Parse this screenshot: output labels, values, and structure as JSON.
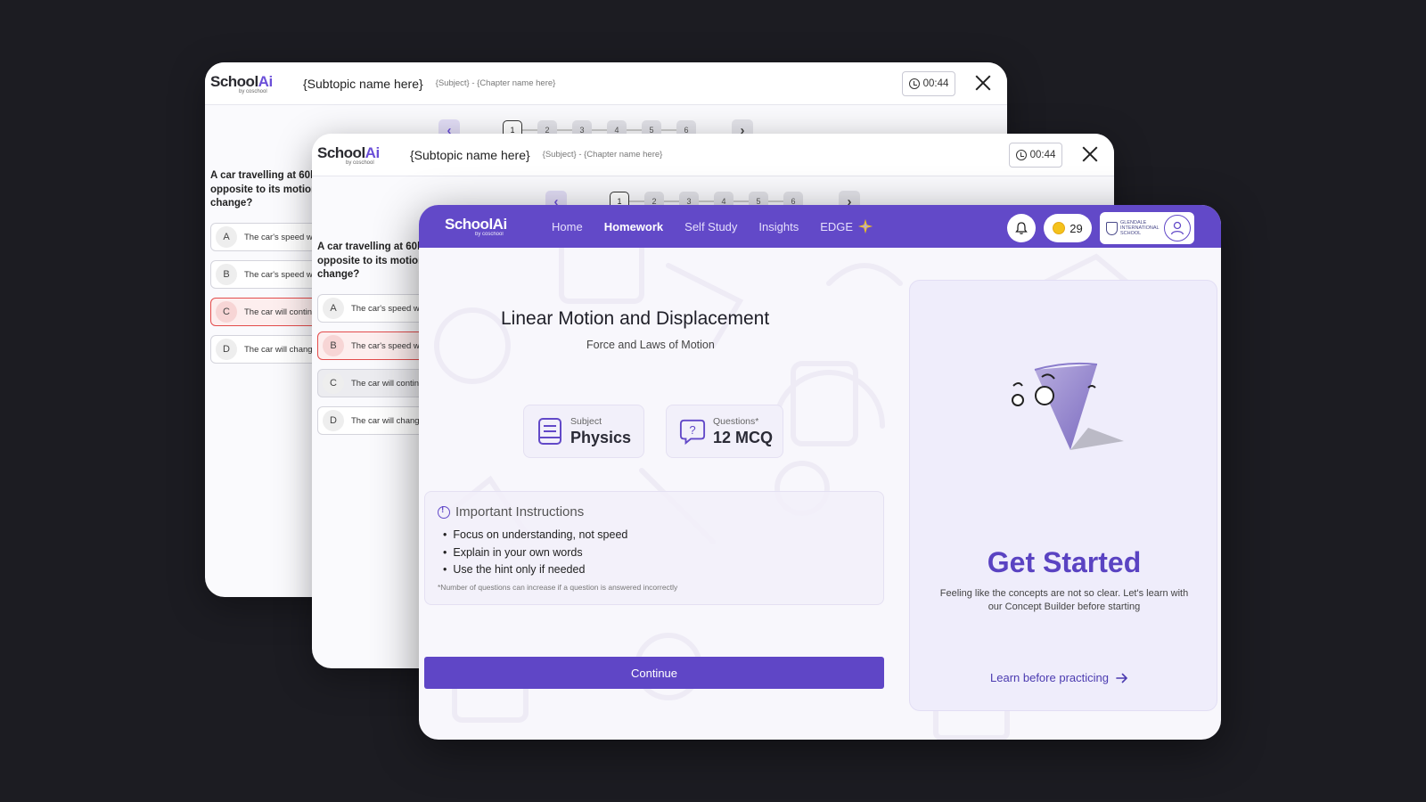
{
  "quiz_window": {
    "logo_text": "School",
    "logo_accent": "Ai",
    "logo_sub": "by coschool",
    "subtopic": "{Subtopic name here}",
    "meta": "{Subject} - {Chapter name here}",
    "timer": "00:44",
    "pages": [
      "1",
      "2",
      "3",
      "4",
      "5",
      "6"
    ],
    "question": "A car travelling at 60km opposite to its motion change?",
    "question_visible": [
      "A car travelling at 60k",
      "opposite to its motion",
      "change?"
    ],
    "options_back": [
      {
        "letter": "A",
        "text": "The car's speed w",
        "state": "default"
      },
      {
        "letter": "B",
        "text": "The car's speed w",
        "state": "default"
      },
      {
        "letter": "C",
        "text": "The car will contin",
        "state": "wrong"
      },
      {
        "letter": "D",
        "text": "The car will chang",
        "state": "default"
      }
    ],
    "options_mid": [
      {
        "letter": "A",
        "text": "The car's speed w",
        "state": "default"
      },
      {
        "letter": "B",
        "text": "The car's speed w",
        "state": "wrong"
      },
      {
        "letter": "C",
        "text": "The car will contin",
        "state": "grey"
      },
      {
        "letter": "D",
        "text": "The car will chang",
        "state": "default"
      }
    ]
  },
  "nav": {
    "logo_text": "School",
    "logo_accent": "Ai",
    "logo_sub": "by coschool",
    "items": [
      {
        "label": "Home",
        "active": false
      },
      {
        "label": "Homework",
        "active": true
      },
      {
        "label": "Self Study",
        "active": false
      },
      {
        "label": "Insights",
        "active": false
      },
      {
        "label": "EDGE",
        "active": false
      }
    ],
    "coins": "29",
    "school_name": "GLENDALE INTERNATIONAL SCHOOL"
  },
  "lesson": {
    "title": "Linear Motion and Displacement",
    "subtitle": "Force and Laws of Motion",
    "subject_label": "Subject",
    "subject_value": "Physics",
    "questions_label": "Questions*",
    "questions_value": "12 MCQ"
  },
  "instructions": {
    "heading": "Important Instructions",
    "items": [
      "Focus on understanding, not speed",
      "Explain in your own words",
      "Use the hint only if needed"
    ],
    "note": "*Number of questions can increase if a question is answered incorrectly"
  },
  "continue_label": "Continue",
  "side": {
    "title": "Get Started",
    "text": "Feeling like the concepts are not so clear. Let's learn with our Concept Builder before starting",
    "link": "Learn before practicing"
  },
  "colors": {
    "brand": "#6249c8",
    "wrong": "#e34b4b",
    "background": "#1c1c22"
  },
  "icons": [
    "clock-icon",
    "close-icon",
    "chevron-left-icon",
    "chevron-right-icon",
    "bell-icon",
    "coin-icon",
    "user-icon",
    "book-icon",
    "question-icon",
    "info-icon",
    "arrow-right-icon",
    "sparkle-icon"
  ]
}
